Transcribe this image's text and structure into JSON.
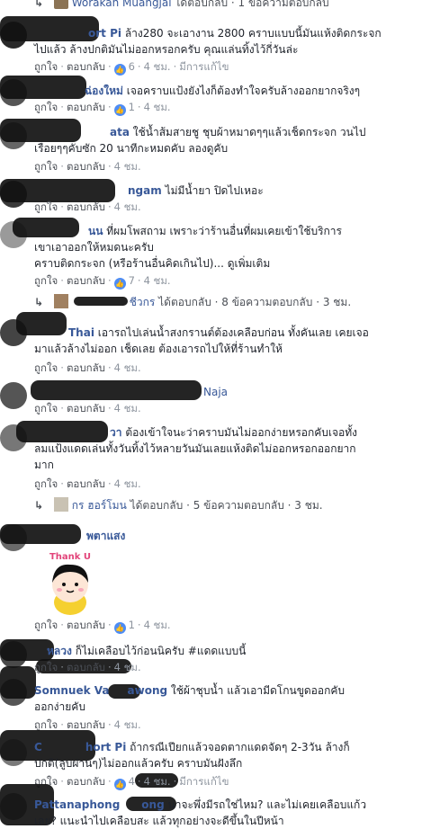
{
  "comments": [
    {
      "id": "c0",
      "reply": {
        "name": "Worakan Muangjai",
        "rest": " ได้ตอบกลับ · 1 ข้อความตอบกลับ"
      }
    },
    {
      "id": "c1",
      "name": "ort Pi",
      "lines": [
        "ล้าง280 จะเอางาน 2800 คราบแบบนี้มันแห้งติดกระจก",
        "ไปแล้ว ล้างปกติมันไม่ออกหรอกครับ คุณแล่นทิ้งไว้กี่วันล่ะ"
      ],
      "actions": {
        "like": "ถูกใจ",
        "reply": "ตอบกลับ",
        "count": "6",
        "time": "4 ชม.",
        "edited": "มีการแก้ไข"
      }
    },
    {
      "id": "c2",
      "name": "ฉ่องใหม่",
      "lines": [
        "เจอคราบแป้งยังไงก็ต้องทำใจครับล้างออกยากจริงๆ"
      ],
      "actions": {
        "like": "ถูกใจ",
        "reply": "ตอบกลับ",
        "count": "1",
        "time": "4 ชม."
      }
    },
    {
      "id": "c3",
      "name": "ata",
      "lines": [
        "ใช้น้ำส้มสายชู ชุบผ้าหมาดๆๆแล้วเช็ดกระจก วนไป",
        "เรื่อยๆๆคับซัก 20 นาทีกะหมดคับ ลองดูคับ"
      ],
      "actions": {
        "like": "ถูกใจ",
        "reply": "ตอบกลับ",
        "time": "4 ชม."
      }
    },
    {
      "id": "c4",
      "name": "ngam",
      "lines": [
        "ไม่มีน้ำยา ปิดไปเหอะ"
      ],
      "actions": {
        "like": "ถูกใจ",
        "reply": "ตอบกลับ",
        "time": "4 ชม."
      }
    },
    {
      "id": "c5",
      "name": "นน",
      "lines": [
        "ที่ผมโพสถาม เพราะว่าร้านอื่นที่ผมเคยเข้าใช้บริการ",
        "เขาเอาออกให้หมดนะครับ",
        "คราบติดกระจก (หรือร้านอื่นคิดเกินไป)... ดูเพิ่มเติม"
      ],
      "actions": {
        "like": "ถูกใจ",
        "reply": "ตอบกลับ",
        "count": "7",
        "time": "4 ชม."
      },
      "reply": {
        "name": "ชีวกร",
        "rest": " ได้ตอบกลับ · 8 ข้อความตอบกลับ · 3 ชม."
      }
    },
    {
      "id": "c6",
      "name": "Thai",
      "lines": [
        "เอารถไปเล่นน้ำสงกรานต์ต้องเคลือบก่อน ทั้งคันเลย เคยเจอ",
        "มาแล้วล้างไม่ออก เช็ดเลย ต้องเอารถไปให้ที่ร้านทำให้"
      ],
      "actions": {
        "like": "ถูกใจ",
        "reply": "ตอบกลับ",
        "time": "4 ชม."
      }
    },
    {
      "id": "c7",
      "name": "",
      "lines": [
        "Naja"
      ],
      "actions": {
        "like": "ถูกใจ",
        "reply": "ตอบกลับ",
        "time": "4 ชม."
      }
    },
    {
      "id": "c8",
      "name": "วา",
      "lines": [
        "ต้องเข้าใจนะว่าคราบมันไม่ออกง่ายหรอกคับเจอทั้ง",
        "ลมแป้งแดดเล่นทั้งวันทิ้งไว้หลายวันมันเลยแห้งติดไม่ออกหรอกออกยาก",
        "มาก"
      ],
      "actions": {
        "like": "ถูกใจ",
        "reply": "ตอบกลับ",
        "time": "4 ชม."
      },
      "reply": {
        "name": "กร ฮอร์โมน",
        "rest": " ได้ตอบกลับ · 5 ข้อความตอบกลับ · 3 ชม."
      }
    },
    {
      "id": "c9",
      "name": "พตาแสง",
      "lines": [],
      "sticker": "Thank U",
      "actions": {
        "like": "ถูกใจ",
        "reply": "ตอบกลับ",
        "count": "1",
        "time": "4 ชม."
      }
    },
    {
      "id": "c10",
      "name": "หลวง",
      "lines": [
        "ก็ไม่เคลือบไว้ก่อนนิครับ #แดดแบบนี้"
      ],
      "actions": {
        "like": "ถูกใจ",
        "reply": "ตอบกลับ",
        "time": "4 ชม."
      }
    },
    {
      "id": "c11",
      "name": "Somnuek Va",
      "nameTail": "awong",
      "lines": [
        "ใช้ผ้าชุบน้ำ แล้วเอามีดโกนขูดออกคับ",
        "ออกง่ายคับ"
      ],
      "actions": {
        "like": "ถูกใจ",
        "reply": "ตอบกลับ",
        "time": "4 ชม."
      }
    },
    {
      "id": "c12",
      "name": "C",
      "nameTail": "hort Pi",
      "lines": [
        "ถ้ากรณีเปียกแล้วจอดตากแดดจัดๆ 2-3วัน ล้างก็",
        "ปกติ(ลูบผ่านๆ)ไม่ออกแล้วครับ คราบมันฝังลึก"
      ],
      "actions": {
        "like": "ถูกใจ",
        "reply": "ตอบกลับ",
        "count": "4",
        "time": "4 ชม.",
        "edited": "มีการแก้ไข"
      }
    },
    {
      "id": "c13",
      "name": "Pattanaphong",
      "nameTail": "ong",
      "lines": [
        "น่าจะพึ่งมีรถใช่ไหม? และไม่เคยเคลือบแก้ว",
        "เลย? แนะนำไปเคลือบสะ แล้วทุกอย่างจะดีขึ้นในปีหน้า"
      ]
    }
  ],
  "colors": {
    "link": "#385898",
    "meta": "#8d949e",
    "like": "#4d8cf5"
  },
  "icons": {
    "reply_arrow": "reply-arrow-icon",
    "like": "like-thumb-icon"
  }
}
